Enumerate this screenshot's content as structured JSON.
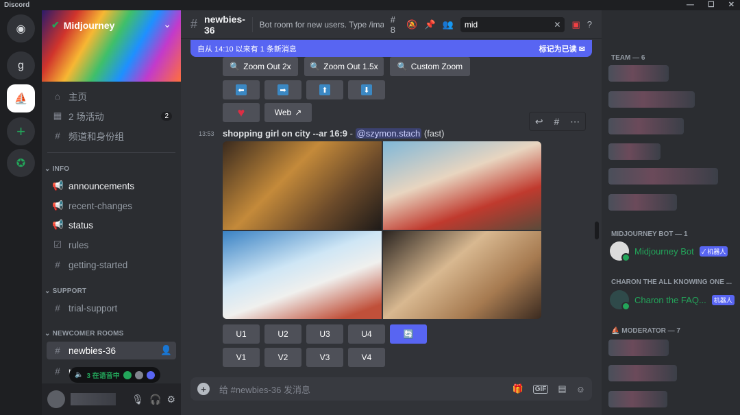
{
  "app": {
    "title": "Discord"
  },
  "guilds": [
    {
      "label": "g"
    }
  ],
  "server": {
    "name": "Midjourney",
    "banner_colors": [
      "#2a1b6a",
      "#f7b733",
      "#1e90ff"
    ]
  },
  "nav": [
    {
      "label": "主页"
    },
    {
      "label": "2 场活动",
      "badge": "2"
    },
    {
      "label": "频道和身份组"
    }
  ],
  "categories": {
    "info": "INFO",
    "support": "SUPPORT",
    "newcomer": "NEWCOMER ROOMS"
  },
  "info_channels": [
    "announcements",
    "recent-changes",
    "status",
    "rules",
    "getting-started"
  ],
  "support_channels": [
    "trial-support"
  ],
  "newcomer_channels": [
    "newbies-36",
    "n"
  ],
  "voice": {
    "label": "3 在语音中"
  },
  "header": {
    "channel": "newbies-36",
    "topic": "Bot room for new users. Type /imagine then d...",
    "threads": "8",
    "search": "mid"
  },
  "new_messages": {
    "text": "自从 14:10 以来有 1 条新消息",
    "mark_read": "标记为已读"
  },
  "buttons_top": [
    "Zoom Out 2x",
    "Zoom Out 1.5x",
    "Custom Zoom"
  ],
  "arrows": [
    "⬅",
    "➡",
    "⬆",
    "⬇"
  ],
  "web_label": "Web",
  "message": {
    "time": "13:53",
    "prompt": "shopping girl on city --ar 16:9",
    "separator": " - ",
    "mention": "@szymon.stach",
    "mode": "(fast)"
  },
  "upscale": [
    "U1",
    "U2",
    "U3",
    "U4"
  ],
  "variation": [
    "V1",
    "V2",
    "V3",
    "V4"
  ],
  "composer": {
    "placeholder": "给 #newbies-36 发消息",
    "gif": "GIF"
  },
  "members": {
    "team": "TEAM — 6",
    "bot_cat": "MIDJOURNEY BOT — 1",
    "bot_name": "Midjourney Bot",
    "bot_tag": "✓ 机器人",
    "charon_cat": "CHARON THE ALL KNOWING ONE ...",
    "charon_name": "Charon the FAQ...",
    "charon_tag": "机器人",
    "mod_cat": "MODERATOR — 7"
  },
  "colors": {
    "accent": "#5865f2",
    "online": "#23a55a"
  }
}
